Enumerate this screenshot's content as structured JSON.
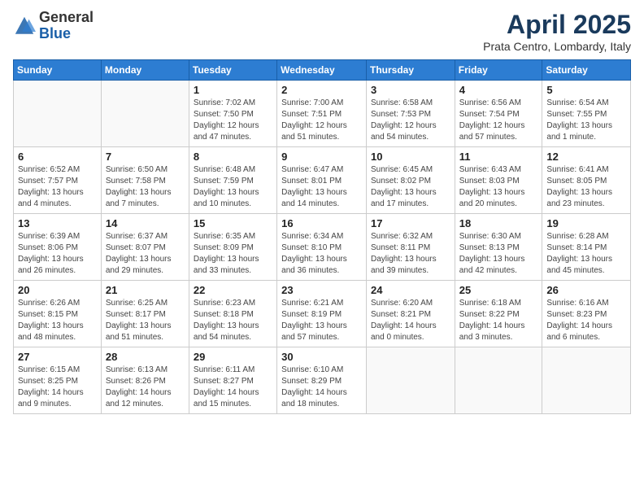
{
  "header": {
    "logo_general": "General",
    "logo_blue": "Blue",
    "month_title": "April 2025",
    "subtitle": "Prata Centro, Lombardy, Italy"
  },
  "days_of_week": [
    "Sunday",
    "Monday",
    "Tuesday",
    "Wednesday",
    "Thursday",
    "Friday",
    "Saturday"
  ],
  "weeks": [
    [
      {
        "day": "",
        "info": ""
      },
      {
        "day": "",
        "info": ""
      },
      {
        "day": "1",
        "info": "Sunrise: 7:02 AM\nSunset: 7:50 PM\nDaylight: 12 hours and 47 minutes."
      },
      {
        "day": "2",
        "info": "Sunrise: 7:00 AM\nSunset: 7:51 PM\nDaylight: 12 hours and 51 minutes."
      },
      {
        "day": "3",
        "info": "Sunrise: 6:58 AM\nSunset: 7:53 PM\nDaylight: 12 hours and 54 minutes."
      },
      {
        "day": "4",
        "info": "Sunrise: 6:56 AM\nSunset: 7:54 PM\nDaylight: 12 hours and 57 minutes."
      },
      {
        "day": "5",
        "info": "Sunrise: 6:54 AM\nSunset: 7:55 PM\nDaylight: 13 hours and 1 minute."
      }
    ],
    [
      {
        "day": "6",
        "info": "Sunrise: 6:52 AM\nSunset: 7:57 PM\nDaylight: 13 hours and 4 minutes."
      },
      {
        "day": "7",
        "info": "Sunrise: 6:50 AM\nSunset: 7:58 PM\nDaylight: 13 hours and 7 minutes."
      },
      {
        "day": "8",
        "info": "Sunrise: 6:48 AM\nSunset: 7:59 PM\nDaylight: 13 hours and 10 minutes."
      },
      {
        "day": "9",
        "info": "Sunrise: 6:47 AM\nSunset: 8:01 PM\nDaylight: 13 hours and 14 minutes."
      },
      {
        "day": "10",
        "info": "Sunrise: 6:45 AM\nSunset: 8:02 PM\nDaylight: 13 hours and 17 minutes."
      },
      {
        "day": "11",
        "info": "Sunrise: 6:43 AM\nSunset: 8:03 PM\nDaylight: 13 hours and 20 minutes."
      },
      {
        "day": "12",
        "info": "Sunrise: 6:41 AM\nSunset: 8:05 PM\nDaylight: 13 hours and 23 minutes."
      }
    ],
    [
      {
        "day": "13",
        "info": "Sunrise: 6:39 AM\nSunset: 8:06 PM\nDaylight: 13 hours and 26 minutes."
      },
      {
        "day": "14",
        "info": "Sunrise: 6:37 AM\nSunset: 8:07 PM\nDaylight: 13 hours and 29 minutes."
      },
      {
        "day": "15",
        "info": "Sunrise: 6:35 AM\nSunset: 8:09 PM\nDaylight: 13 hours and 33 minutes."
      },
      {
        "day": "16",
        "info": "Sunrise: 6:34 AM\nSunset: 8:10 PM\nDaylight: 13 hours and 36 minutes."
      },
      {
        "day": "17",
        "info": "Sunrise: 6:32 AM\nSunset: 8:11 PM\nDaylight: 13 hours and 39 minutes."
      },
      {
        "day": "18",
        "info": "Sunrise: 6:30 AM\nSunset: 8:13 PM\nDaylight: 13 hours and 42 minutes."
      },
      {
        "day": "19",
        "info": "Sunrise: 6:28 AM\nSunset: 8:14 PM\nDaylight: 13 hours and 45 minutes."
      }
    ],
    [
      {
        "day": "20",
        "info": "Sunrise: 6:26 AM\nSunset: 8:15 PM\nDaylight: 13 hours and 48 minutes."
      },
      {
        "day": "21",
        "info": "Sunrise: 6:25 AM\nSunset: 8:17 PM\nDaylight: 13 hours and 51 minutes."
      },
      {
        "day": "22",
        "info": "Sunrise: 6:23 AM\nSunset: 8:18 PM\nDaylight: 13 hours and 54 minutes."
      },
      {
        "day": "23",
        "info": "Sunrise: 6:21 AM\nSunset: 8:19 PM\nDaylight: 13 hours and 57 minutes."
      },
      {
        "day": "24",
        "info": "Sunrise: 6:20 AM\nSunset: 8:21 PM\nDaylight: 14 hours and 0 minutes."
      },
      {
        "day": "25",
        "info": "Sunrise: 6:18 AM\nSunset: 8:22 PM\nDaylight: 14 hours and 3 minutes."
      },
      {
        "day": "26",
        "info": "Sunrise: 6:16 AM\nSunset: 8:23 PM\nDaylight: 14 hours and 6 minutes."
      }
    ],
    [
      {
        "day": "27",
        "info": "Sunrise: 6:15 AM\nSunset: 8:25 PM\nDaylight: 14 hours and 9 minutes."
      },
      {
        "day": "28",
        "info": "Sunrise: 6:13 AM\nSunset: 8:26 PM\nDaylight: 14 hours and 12 minutes."
      },
      {
        "day": "29",
        "info": "Sunrise: 6:11 AM\nSunset: 8:27 PM\nDaylight: 14 hours and 15 minutes."
      },
      {
        "day": "30",
        "info": "Sunrise: 6:10 AM\nSunset: 8:29 PM\nDaylight: 14 hours and 18 minutes."
      },
      {
        "day": "",
        "info": ""
      },
      {
        "day": "",
        "info": ""
      },
      {
        "day": "",
        "info": ""
      }
    ]
  ]
}
